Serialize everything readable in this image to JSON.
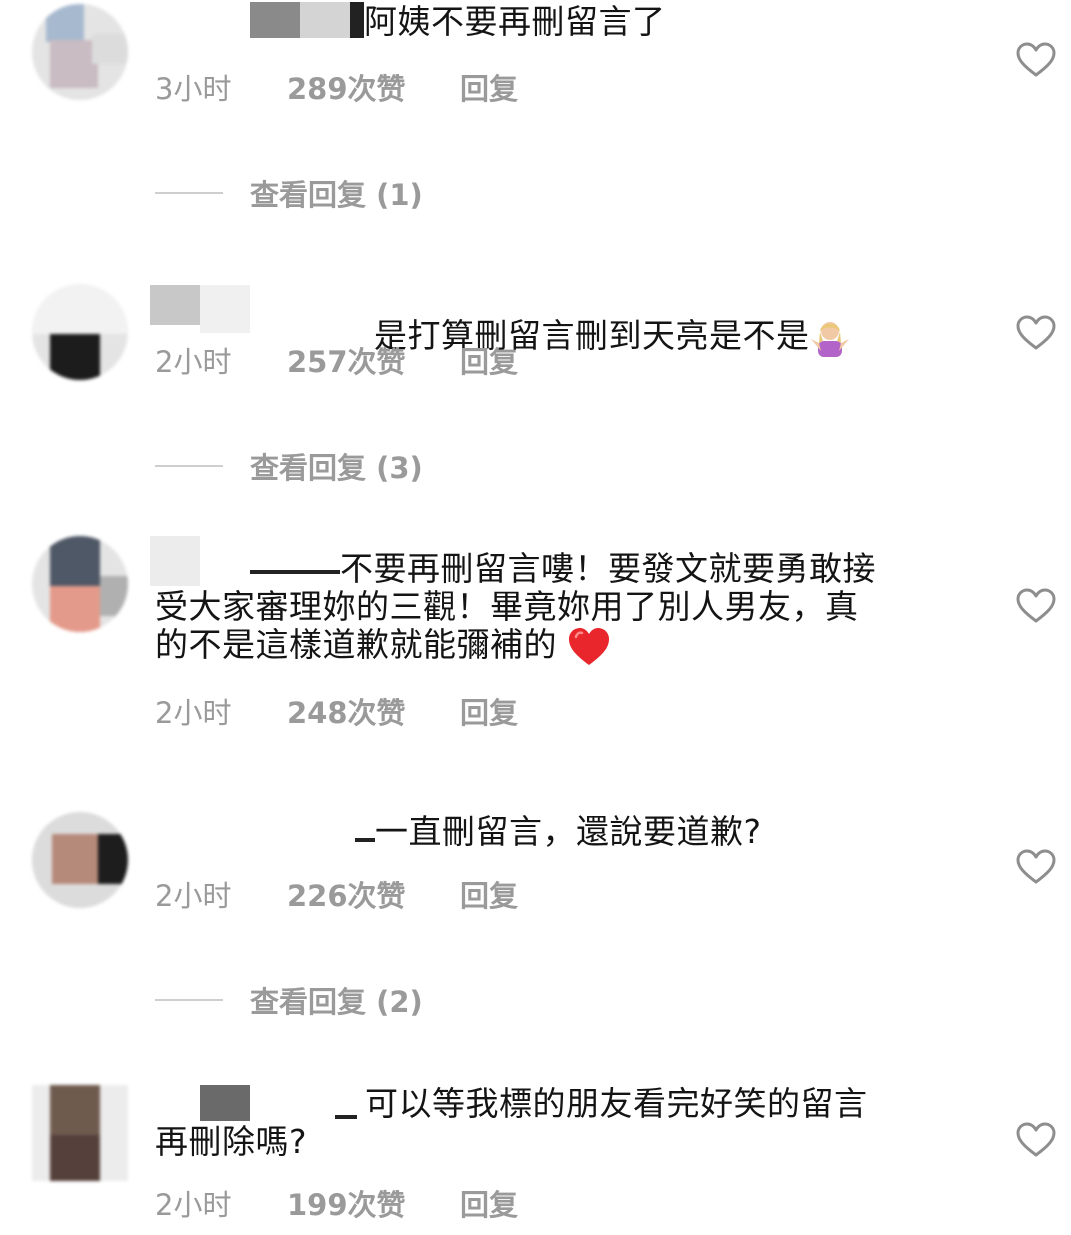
{
  "comments": [
    {
      "text": "阿姨不要再刪留言了",
      "time": "3小时",
      "likes": "289次赞",
      "reply": "回复",
      "view_replies": "查看回复 (1)"
    },
    {
      "text": "是打算刪留言刪到天亮是不是",
      "time": "2小时",
      "likes": "257次赞",
      "reply": "回复",
      "view_replies": "查看回复 (3)"
    },
    {
      "text_line1": "不要再刪留言嘍！要發文就要勇敢接",
      "text_line2": "受大家審理妳的三觀！畢竟妳用了別人男友，真",
      "text_line3": "的不是這樣道歉就能彌補的",
      "time": "2小时",
      "likes": "248次赞",
      "reply": "回复"
    },
    {
      "text": "一直刪留言，還說要道歉?",
      "time": "2小时",
      "likes": "226次赞",
      "reply": "回复",
      "view_replies": "查看回复 (2)"
    },
    {
      "text_line1": "可以等我標的朋友看完好笑的留言",
      "text_line2": "再刪除嗎?",
      "time": "2小时",
      "likes": "199次赞",
      "reply": "回复"
    }
  ],
  "icons": {
    "like": "heart-outline-icon",
    "emoji_shrug": "woman-shrugging-emoji",
    "emoji_heart": "red-heart-emoji"
  },
  "colors": {
    "text": "#141414",
    "meta": "#9a9a9a",
    "heart": "#8e8e8e"
  }
}
